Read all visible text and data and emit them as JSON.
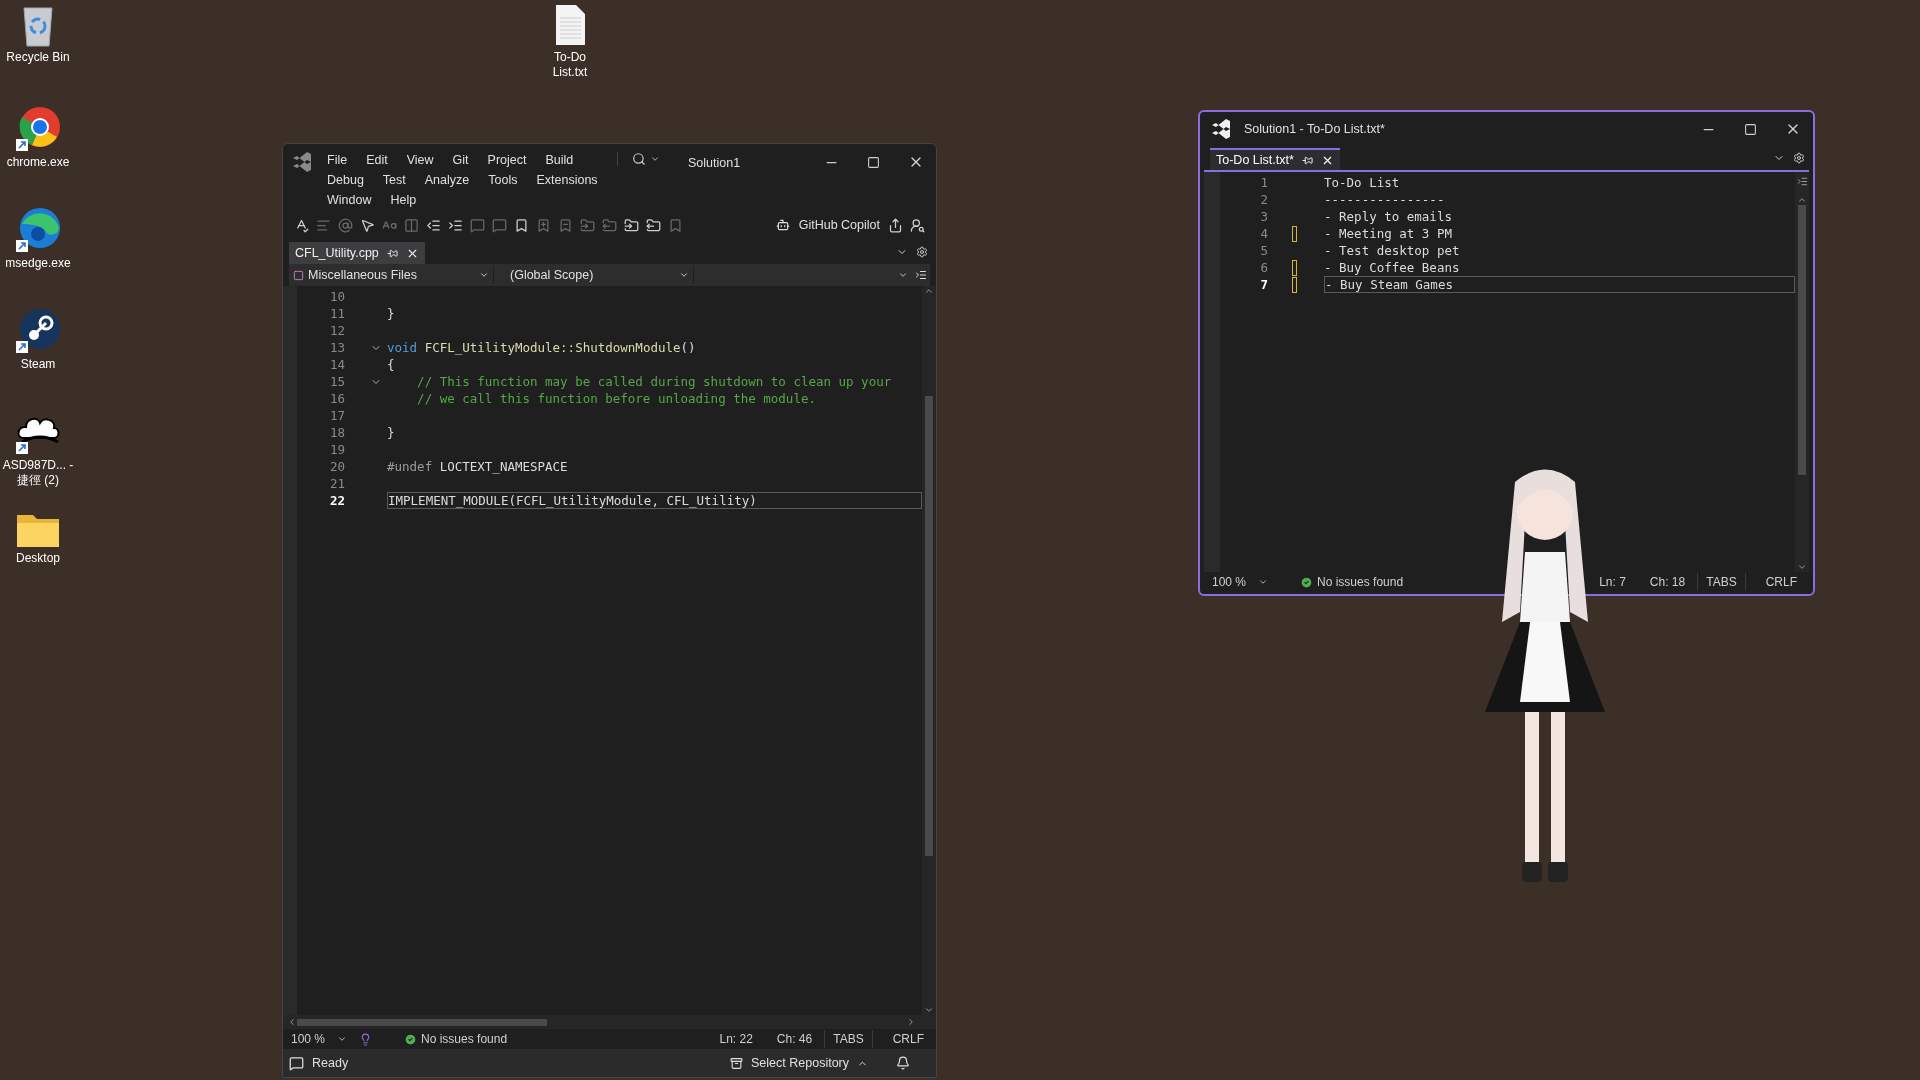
{
  "desktop_icons": [
    {
      "label": "Recycle Bin",
      "kind": "recycle"
    },
    {
      "label": "chrome.exe",
      "kind": "chrome"
    },
    {
      "label": "msedge.exe",
      "kind": "edge"
    },
    {
      "label": "Steam",
      "kind": "steam"
    },
    {
      "label": "ASD987D... - 捷徑 (2)",
      "kind": "cloud"
    },
    {
      "label": "Desktop",
      "kind": "folder"
    }
  ],
  "file_icon": {
    "label": "To-Do List.txt"
  },
  "left_window": {
    "active": false,
    "title": "Solution1",
    "menu_rows": [
      [
        "File",
        "Edit",
        "View",
        "Git",
        "Project",
        "Build"
      ],
      [
        "Debug",
        "Test",
        "Analyze",
        "Tools",
        "Extensions"
      ],
      [
        "Window",
        "Help"
      ]
    ],
    "copilot": "GitHub Copilot",
    "tabs": [
      {
        "label": "CFL_Utility.cpp",
        "selected": true
      }
    ],
    "nav": [
      "Miscellaneous Files",
      "(Global Scope)"
    ],
    "lines": [
      {
        "number": "10",
        "current": false,
        "foldable": false,
        "changed": false
      },
      {
        "number": "11",
        "current": false,
        "foldable": false,
        "changed": false,
        "tokens": [
          {
            "kind": "plain",
            "text": "}"
          }
        ]
      },
      {
        "number": "12",
        "current": false,
        "foldable": false,
        "changed": false
      },
      {
        "number": "13",
        "current": false,
        "foldable": true,
        "changed": false,
        "tokens": [
          {
            "kind": "keyword",
            "text": "void"
          },
          {
            "kind": "function",
            "text": " FCFL_UtilityModule::ShutdownModule"
          },
          {
            "kind": "plain",
            "text": "()"
          }
        ]
      },
      {
        "number": "14",
        "current": false,
        "foldable": false,
        "changed": false,
        "tokens": [
          {
            "kind": "plain",
            "text": "{"
          }
        ]
      },
      {
        "number": "15",
        "current": false,
        "foldable": true,
        "changed": false,
        "tokens": [
          {
            "kind": "comment",
            "text": "    // This function may be called during shutdown to clean up your"
          }
        ]
      },
      {
        "number": "16",
        "current": false,
        "foldable": false,
        "changed": false,
        "tokens": [
          {
            "kind": "comment",
            "text": "    // we call this function before unloading the module."
          }
        ]
      },
      {
        "number": "17",
        "current": false,
        "foldable": false,
        "changed": false
      },
      {
        "number": "18",
        "current": false,
        "foldable": false,
        "changed": false,
        "tokens": [
          {
            "kind": "plain",
            "text": "}"
          }
        ]
      },
      {
        "number": "19",
        "current": false,
        "foldable": false,
        "changed": false
      },
      {
        "number": "20",
        "current": false,
        "foldable": false,
        "changed": false,
        "tokens": [
          {
            "kind": "preproc",
            "text": "#undef"
          },
          {
            "kind": "plain",
            "text": " LOCTEXT_NAMESPACE"
          }
        ]
      },
      {
        "number": "21",
        "current": false,
        "foldable": false,
        "changed": false
      },
      {
        "number": "22",
        "current": true,
        "foldable": false,
        "changed": false,
        "tokens": [
          {
            "kind": "macro",
            "text": "IMPLEMENT_MODULE(FCFL_UtilityModule, CFL_Utility)"
          }
        ]
      }
    ],
    "status": {
      "zoom": "100 %",
      "issues": "No issues found",
      "ln": "Ln: 22",
      "ch": "Ch: 46",
      "indent": "TABS",
      "eol": "CRLF"
    },
    "bottom_bar": {
      "state": "Ready",
      "repo": "Select Repository"
    }
  },
  "right_window": {
    "active": true,
    "title": "Solution1 - To-Do List.txt*",
    "tabs": [
      {
        "label": "To-Do List.txt*",
        "selected": true
      }
    ],
    "lines": [
      {
        "number": "1",
        "current": false,
        "foldable": false,
        "changed": false,
        "tokens": [
          {
            "kind": "plain",
            "text": "To-Do List"
          }
        ]
      },
      {
        "number": "2",
        "current": false,
        "foldable": false,
        "changed": false,
        "tokens": [
          {
            "kind": "plain",
            "text": "----------------"
          }
        ]
      },
      {
        "number": "3",
        "current": false,
        "foldable": false,
        "changed": false,
        "tokens": [
          {
            "kind": "plain",
            "text": "- Reply to emails"
          }
        ]
      },
      {
        "number": "4",
        "current": false,
        "foldable": false,
        "changed": true,
        "tokens": [
          {
            "kind": "plain",
            "text": "- Meeting at 3 PM"
          }
        ]
      },
      {
        "number": "5",
        "current": false,
        "foldable": false,
        "changed": false,
        "tokens": [
          {
            "kind": "plain",
            "text": "- Test desktop pet"
          }
        ]
      },
      {
        "number": "6",
        "current": false,
        "foldable": false,
        "changed": true,
        "tokens": [
          {
            "kind": "plain",
            "text": "- Buy Coffee Beans"
          }
        ]
      },
      {
        "number": "7",
        "current": true,
        "foldable": false,
        "changed": true,
        "tokens": [
          {
            "kind": "plain",
            "text": "- Buy Steam Games"
          }
        ]
      }
    ],
    "status": {
      "zoom": "100 %",
      "issues": "No issues found",
      "ln": "Ln: 7",
      "ch": "Ch: 18",
      "indent": "TABS",
      "eol": "CRLF"
    }
  }
}
